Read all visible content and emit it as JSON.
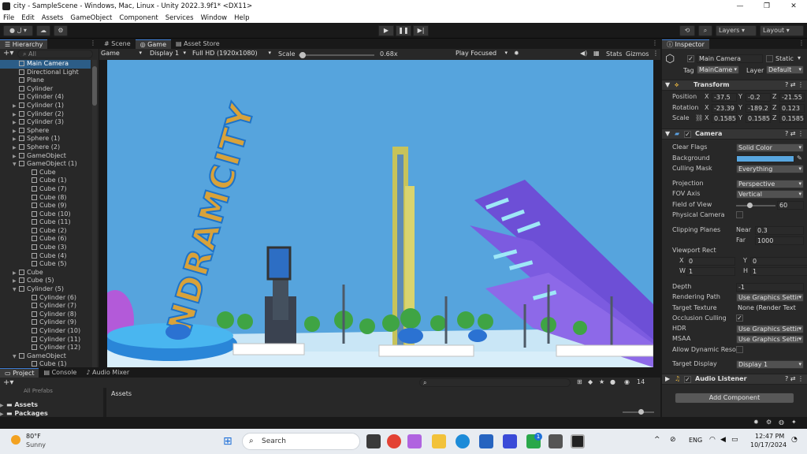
{
  "window": {
    "title": "city - SampleScene - Windows, Mac, Linux - Unity 2022.3.9f1* <DX11>",
    "min": "—",
    "max": "❐",
    "close": "✕"
  },
  "menu": [
    "File",
    "Edit",
    "Assets",
    "GameObject",
    "Component",
    "Services",
    "Window",
    "Help"
  ],
  "toolbar": {
    "account": "ل",
    "layers": "Layers",
    "layout": "Layout",
    "play": "▶",
    "pause": "❚❚",
    "step": "▶|"
  },
  "hierarchy": {
    "tab": "Hierarchy",
    "search": "All",
    "items": [
      {
        "label": "Main Camera",
        "indent": 3,
        "sel": true
      },
      {
        "label": "Directional Light",
        "indent": 3
      },
      {
        "label": "Plane",
        "indent": 3
      },
      {
        "label": "Cylinder",
        "indent": 3
      },
      {
        "label": "Cylinder (4)",
        "indent": 3
      },
      {
        "label": "Cylinder (1)",
        "indent": 3,
        "arrow": "▶"
      },
      {
        "label": "Cylinder (2)",
        "indent": 3,
        "arrow": "▶"
      },
      {
        "label": "Cylinder (3)",
        "indent": 3,
        "arrow": "▶"
      },
      {
        "label": "Sphere",
        "indent": 3,
        "arrow": "▶"
      },
      {
        "label": "Sphere (1)",
        "indent": 3,
        "arrow": "▶"
      },
      {
        "label": "Sphere (2)",
        "indent": 3,
        "arrow": "▶"
      },
      {
        "label": "GameObject",
        "indent": 3,
        "arrow": "▶"
      },
      {
        "label": "GameObject (1)",
        "indent": 3,
        "arrow": "▼"
      },
      {
        "label": "Cube",
        "indent": 5
      },
      {
        "label": "Cube (1)",
        "indent": 5
      },
      {
        "label": "Cube (7)",
        "indent": 5
      },
      {
        "label": "Cube (8)",
        "indent": 5
      },
      {
        "label": "Cube (9)",
        "indent": 5
      },
      {
        "label": "Cube (10)",
        "indent": 5
      },
      {
        "label": "Cube (11)",
        "indent": 5
      },
      {
        "label": "Cube (2)",
        "indent": 5
      },
      {
        "label": "Cube (6)",
        "indent": 5
      },
      {
        "label": "Cube (3)",
        "indent": 5
      },
      {
        "label": "Cube (4)",
        "indent": 5
      },
      {
        "label": "Cube (5)",
        "indent": 5
      },
      {
        "label": "Cube",
        "indent": 3,
        "arrow": "▶"
      },
      {
        "label": "Cube (5)",
        "indent": 3,
        "arrow": "▶"
      },
      {
        "label": "Cylinder (5)",
        "indent": 3,
        "arrow": "▼"
      },
      {
        "label": "Cylinder (6)",
        "indent": 5
      },
      {
        "label": "Cylinder (7)",
        "indent": 5
      },
      {
        "label": "Cylinder (8)",
        "indent": 5
      },
      {
        "label": "Cylinder (9)",
        "indent": 5
      },
      {
        "label": "Cylinder (10)",
        "indent": 5
      },
      {
        "label": "Cylinder (11)",
        "indent": 5
      },
      {
        "label": "Cylinder (12)",
        "indent": 5
      },
      {
        "label": "GameObject",
        "indent": 3,
        "arrow": "▼"
      },
      {
        "label": "Cube (1)",
        "indent": 5
      }
    ]
  },
  "center": {
    "tabs": [
      "Scene",
      "Game",
      "Asset Store"
    ],
    "game_bar": {
      "mode": "Game",
      "display": "Display 1",
      "resolution": "Full HD (1920x1080)",
      "scale_label": "Scale",
      "scale_value": "0.68x",
      "play_focused": "Play Focused",
      "stats": "Stats",
      "gizmos": "Gizmos",
      "scale_fraction": 0.05
    },
    "sign_text": "NDRAMCITY"
  },
  "project": {
    "tabs": [
      "Project",
      "Console",
      "Audio Mixer"
    ],
    "all_prefabs": "All Prefabs",
    "tree": [
      "Assets",
      "Packages"
    ],
    "breadcrumb": "Assets",
    "count": "14"
  },
  "inspector": {
    "tab": "Inspector",
    "name": "Main Camera",
    "static": "Static",
    "tag_label": "Tag",
    "tag": "MainCame",
    "layer_label": "Layer",
    "layer": "Default",
    "transform": {
      "title": "Transform",
      "position": {
        "label": "Position",
        "x": "-37.5",
        "y": "-0.2",
        "z": "-21.55"
      },
      "rotation": {
        "label": "Rotation",
        "x": "-23.39",
        "y": "-189.2",
        "z": "0.123"
      },
      "scale": {
        "label": "Scale",
        "x": "0.1585",
        "y": "0.1585",
        "z": "0.1585"
      }
    },
    "camera": {
      "title": "Camera",
      "clear_flags": {
        "label": "Clear Flags",
        "value": "Solid Color"
      },
      "background": {
        "label": "Background",
        "color": "#58a6df"
      },
      "culling_mask": {
        "label": "Culling Mask",
        "value": "Everything"
      },
      "projection": {
        "label": "Projection",
        "value": "Perspective"
      },
      "fov_axis": {
        "label": "FOV Axis",
        "value": "Vertical"
      },
      "fov": {
        "label": "Field of View",
        "value": "60",
        "fraction": 0.33
      },
      "physical": {
        "label": "Physical Camera"
      },
      "clipping": {
        "label": "Clipping Planes",
        "near_label": "Near",
        "near": "0.3",
        "far_label": "Far",
        "far": "1000"
      },
      "viewport": {
        "label": "Viewport Rect",
        "x_label": "X",
        "x": "0",
        "y_label": "Y",
        "y": "0",
        "w_label": "W",
        "w": "1",
        "h_label": "H",
        "h": "1"
      },
      "depth": {
        "label": "Depth",
        "value": "-1"
      },
      "rendering_path": {
        "label": "Rendering Path",
        "value": "Use Graphics Settir"
      },
      "target_texture": {
        "label": "Target Texture",
        "value": "None (Render Text"
      },
      "occlusion": {
        "label": "Occlusion Culling",
        "check": "✓"
      },
      "hdr": {
        "label": "HDR",
        "value": "Use Graphics Settir"
      },
      "msaa": {
        "label": "MSAA",
        "value": "Use Graphics Settir"
      },
      "dynamic_res": {
        "label": "Allow Dynamic Reso"
      },
      "target_display": {
        "label": "Target Display",
        "value": "Display 1"
      }
    },
    "audio_listener": "Audio Listener",
    "add_component": "Add Component"
  },
  "taskbar": {
    "temp": "80°F",
    "weather": "Sunny",
    "search": "Search",
    "lang": "ENG",
    "time": "12:47 PM",
    "date": "10/17/2024",
    "badge": "1"
  }
}
